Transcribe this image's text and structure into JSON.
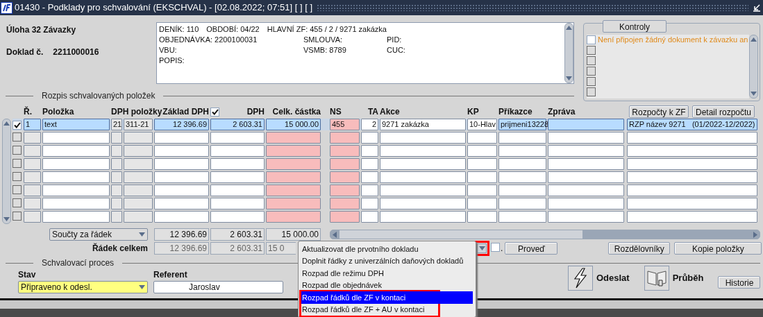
{
  "window": {
    "title": "01430 - Podklady pro schvalování (EKSCHVAL) - [02.08.2022; 07:51] [ ] [ ]"
  },
  "header": {
    "task": "Úloha 32 Závazky",
    "doc_label": "Doklad č.",
    "doc_number": "2211000016"
  },
  "info_box": {
    "lines": [
      [
        "DENÍK: 110",
        "OBDOBÍ: 04/22",
        "HLAVNÍ ZF: 455 / 2 / 9271 zakázka"
      ],
      [
        "OBJEDNÁVKA: 2200100031",
        "SMLOUVA:",
        "PID:"
      ],
      [
        "VBU:",
        "VSMB: 8789",
        "CUC:"
      ],
      [
        "POPIS:"
      ]
    ]
  },
  "checks": {
    "button": "Kontroly",
    "items": [
      {
        "checked": false,
        "text": "Není připojen žádný dokument k závazku an"
      },
      {
        "checked": false
      },
      {
        "checked": false
      },
      {
        "checked": false
      },
      {
        "checked": false
      },
      {
        "checked": false
      }
    ]
  },
  "items": {
    "title": "Rozpis schvalovaných položek",
    "header_checked": true,
    "columns": [
      {
        "label": "Ř.",
        "kind": "display",
        "row_highlight": true
      },
      {
        "label": "Položka",
        "kind": "input",
        "row_highlight": true
      },
      {
        "label": "DPH položky",
        "kind": "display",
        "row_highlight": false
      },
      {
        "kind": "display",
        "row_highlight": false
      },
      {
        "label": "Základ DPH",
        "kind": "input",
        "row_highlight": true
      },
      {
        "label": "DPH",
        "kind": "input",
        "row_highlight": true
      },
      {
        "label": "Celk. částka",
        "kind": "required",
        "row_highlight": true
      },
      {
        "label": "NS",
        "kind": "required",
        "row_highlight": false
      },
      {
        "label": "TA",
        "kind": "input",
        "row_highlight": false
      },
      {
        "label": "Akce",
        "kind": "input",
        "row_highlight": false
      },
      {
        "label": "KP",
        "kind": "input",
        "row_highlight": false
      },
      {
        "label": "Příkazce",
        "kind": "input",
        "row_highlight": true
      },
      {
        "label": "Zpráva",
        "kind": "input",
        "row_highlight": true
      },
      {
        "kind": "input",
        "row_highlight": true
      }
    ],
    "buttons": [
      "Rozpočty k ZF",
      "Detail rozpočtu"
    ],
    "rows": [
      {
        "selected": true,
        "checked": true,
        "cells": [
          "1",
          "text",
          "21",
          "311-21",
          "12 396.69",
          "2 603.31",
          "15 000.00",
          "455",
          "2",
          "9271 zakázka",
          "10-Hlav",
          "prijmeni13228",
          "",
          "RZP název 9271   (01/2022-12/2022)"
        ]
      },
      {
        "selected": false,
        "checked": false
      },
      {
        "selected": false,
        "checked": false
      },
      {
        "selected": false,
        "checked": false
      },
      {
        "selected": false,
        "checked": false
      },
      {
        "selected": false,
        "checked": false
      },
      {
        "selected": false,
        "checked": false
      },
      {
        "selected": false,
        "checked": false
      }
    ],
    "sum_selector": "Součty za řádek",
    "sums": [
      "12 396.69",
      "2 603.31",
      "15 000.00"
    ],
    "total_label": "Řádek celkem",
    "totals": [
      "12 396.69",
      "2 603.31",
      "15 0"
    ]
  },
  "actions": {
    "menu": [
      {
        "label": "Aktualizovat dle prvotního dokladu",
        "selected": false
      },
      {
        "label": "Doplnit řádky z univerzálních daňových dokladů",
        "selected": false
      },
      {
        "label": "Rozpad dle režimu DPH",
        "selected": false
      },
      {
        "label": "Rozpad dle objednávek",
        "selected": false
      },
      {
        "label": "Rozpad řádků dle ZF v kontaci",
        "selected": true
      },
      {
        "label": "Rozpad řádků dle ZF + AU v kontaci",
        "selected": false
      }
    ],
    "option_checked": false,
    "dot": ".",
    "run": "Proveď",
    "buttons": [
      "Rozdělovníky",
      "Kopie položky"
    ]
  },
  "approval": {
    "title": "Schvalovací proces",
    "state_label": "Stav",
    "state": "Připraveno k odesl.",
    "referent_label": "Referent",
    "referent": "Jaroslav",
    "send": "Odeslat",
    "progress": "Průběh",
    "history": "Historie"
  }
}
